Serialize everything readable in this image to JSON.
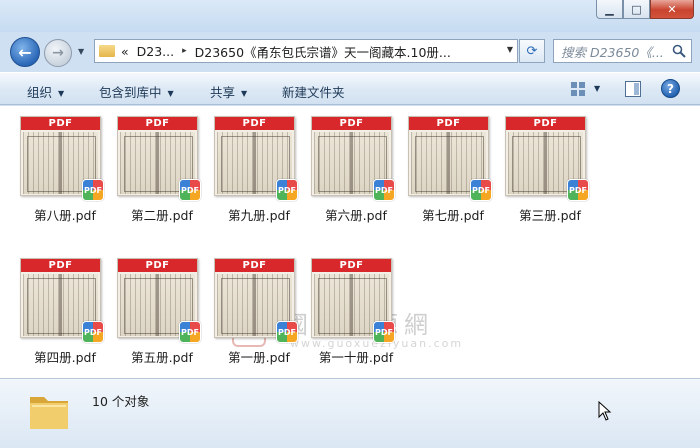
{
  "window": {
    "minimize_glyph": "▁",
    "maximize_glyph": "□",
    "close_glyph": "✕"
  },
  "nav": {
    "back_glyph": "←",
    "forward_glyph": "→",
    "history_glyph": "▼",
    "breadcrumb_prefix": "«",
    "breadcrumb_1": "D23...",
    "breadcrumb_sep": "▸",
    "breadcrumb_2": "D23650《甬东包氏宗谱》天一阁藏本.10册...",
    "address_dropdown_glyph": "▼",
    "refresh_glyph": "⟳",
    "search_placeholder": "搜索 D23650《...",
    "search_icon": "search-icon"
  },
  "toolbar": {
    "organize": "组织",
    "include_in_library": "包含到库中",
    "share": "共享",
    "new_folder": "新建文件夹",
    "caret": "▼",
    "view_dropdown_glyph": "▼",
    "help_glyph": "?"
  },
  "files": [
    {
      "name": "第八册.pdf",
      "banner": "PDF",
      "badge": "PDF"
    },
    {
      "name": "第二册.pdf",
      "banner": "PDF",
      "badge": "PDF"
    },
    {
      "name": "第九册.pdf",
      "banner": "PDF",
      "badge": "PDF"
    },
    {
      "name": "第六册.pdf",
      "banner": "PDF",
      "badge": "PDF"
    },
    {
      "name": "第七册.pdf",
      "banner": "PDF",
      "badge": "PDF"
    },
    {
      "name": "第三册.pdf",
      "banner": "PDF",
      "badge": "PDF"
    },
    {
      "name": "第四册.pdf",
      "banner": "PDF",
      "badge": "PDF"
    },
    {
      "name": "第五册.pdf",
      "banner": "PDF",
      "badge": "PDF"
    },
    {
      "name": "第一册.pdf",
      "banner": "PDF",
      "badge": "PDF"
    },
    {
      "name": "第一十册.pdf",
      "banner": "PDF",
      "badge": "PDF"
    }
  ],
  "watermark": {
    "seal": "国",
    "title": "國學資源網",
    "url": "www.guoxueziyuan.com"
  },
  "status": {
    "count_text": "10 个对象"
  },
  "colors": {
    "pdf_banner": "#d9282b",
    "accent_blue": "#2a67b7",
    "folder_yellow": "#e5b64b"
  }
}
